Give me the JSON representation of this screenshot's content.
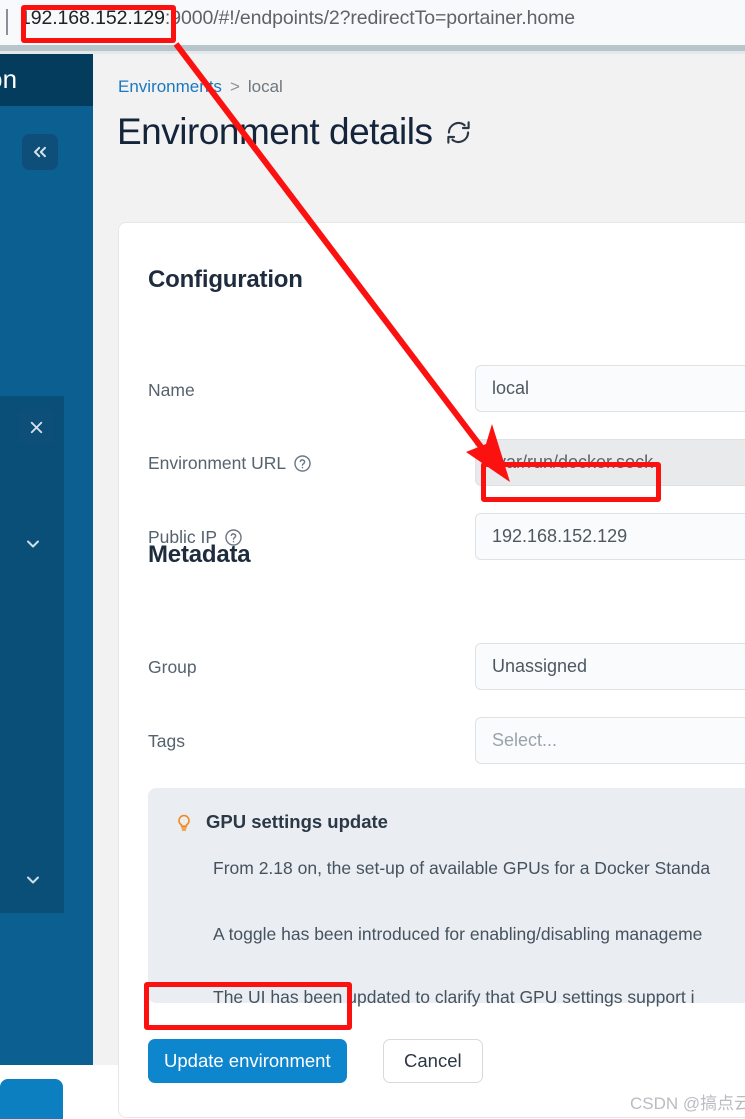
{
  "browser": {
    "url_host": "192.168.152.129",
    "url_rest": ":9000/#!/endpoints/2?redirectTo=portainer.home"
  },
  "sidebar": {
    "header_text": "on",
    "collapse_icon": "double-chevron-left-icon",
    "close_icon": "close-icon",
    "chevron_down_icon": "chevron-down-icon",
    "chevron_up_icon": "chevron-up-icon"
  },
  "breadcrumb": {
    "root": "Environments",
    "separator": ">",
    "leaf": "local"
  },
  "header": {
    "title": "Environment details",
    "refresh_icon": "refresh-icon"
  },
  "configuration": {
    "section_title": "Configuration",
    "fields": [
      {
        "label": "Name",
        "value": "local",
        "has_help": false,
        "disabled": false,
        "placeholder": false
      },
      {
        "label": "Environment URL",
        "value": "/var/run/docker.sock",
        "has_help": true,
        "disabled": true,
        "placeholder": false
      },
      {
        "label": "Public IP",
        "value": "192.168.152.129",
        "has_help": true,
        "disabled": false,
        "placeholder": false
      }
    ]
  },
  "metadata": {
    "section_title": "Metadata",
    "fields": [
      {
        "label": "Group",
        "value": "Unassigned",
        "placeholder": false
      },
      {
        "label": "Tags",
        "value": "Select...",
        "placeholder": true
      }
    ]
  },
  "gpu_panel": {
    "icon": "lightbulb-icon",
    "heading": "GPU settings update",
    "lines": [
      "From 2.18 on, the set-up of available GPUs for a Docker Standa",
      "A toggle has been introduced for enabling/disabling manageme",
      "The UI has been updated to clarify that GPU settings support i"
    ]
  },
  "actions": {
    "update_label": "Update environment",
    "cancel_label": "Cancel"
  },
  "watermark": "CSDN @搞点云南白药",
  "colors": {
    "accent_blue": "#0e86cd",
    "sidebar_blue": "#0c5f91",
    "sidebar_header": "#043c5e",
    "annotation_red": "#fc1111",
    "bulb_orange": "#f08c1e",
    "link_blue": "#1b78bd"
  }
}
